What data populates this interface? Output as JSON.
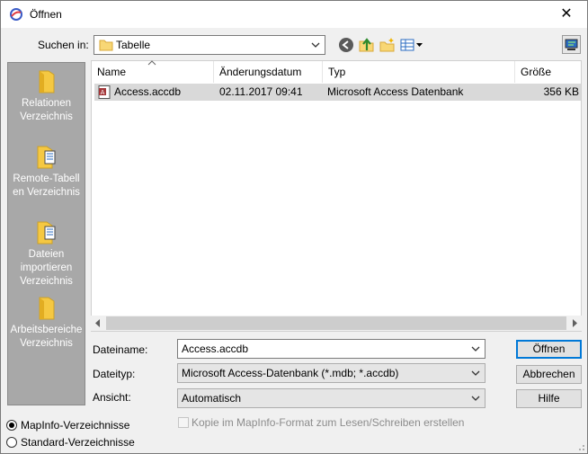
{
  "window": {
    "title": "Öffnen",
    "close_glyph": "✕"
  },
  "lookin": {
    "label": "Suchen in:",
    "value": "Tabelle"
  },
  "toolbar": {
    "icons": [
      "back-icon",
      "up-folder-icon",
      "new-folder-icon",
      "view-menu-icon",
      "network-icon"
    ]
  },
  "sidebar": {
    "items": [
      {
        "label": "Relationen Verzeichnis",
        "icon": "folder-icon"
      },
      {
        "label": "Remote-Tabellen Verzeichnis",
        "icon": "folder-document-icon"
      },
      {
        "label": "Dateien importieren Verzeichnis",
        "icon": "folder-document-icon"
      },
      {
        "label": "Arbeitsbereiche Verzeichnis",
        "icon": "folder-icon"
      }
    ]
  },
  "filelist": {
    "columns": [
      "Name",
      "Änderungsdatum",
      "Typ",
      "Größe"
    ],
    "rows": [
      {
        "name": "Access.accdb",
        "date": "02.11.2017 09:41",
        "type": "Microsoft Access Datenbank",
        "size": "356 KB",
        "selected": true
      }
    ]
  },
  "form": {
    "filename_label": "Dateiname:",
    "filename_value": "Access.accdb",
    "filetype_label": "Dateityp:",
    "filetype_value": "Microsoft Access-Datenbank (*.mdb; *.accdb)",
    "view_label": "Ansicht:",
    "view_value": "Automatisch"
  },
  "buttons": {
    "open": "Öffnen",
    "cancel": "Abbrechen",
    "help": "Hilfe"
  },
  "options": {
    "copy_label": "Kopie im MapInfo-Format zum Lesen/Schreiben erstellen",
    "copy_checked": false,
    "radio1": "MapInfo-Verzeichnisse",
    "radio2": "Standard-Verzeichnisse",
    "radio_selected": 1
  },
  "colors": {
    "accent": "#0078d7",
    "sidebar": "#a8a8a8",
    "selected_row": "#d9d9d9"
  }
}
